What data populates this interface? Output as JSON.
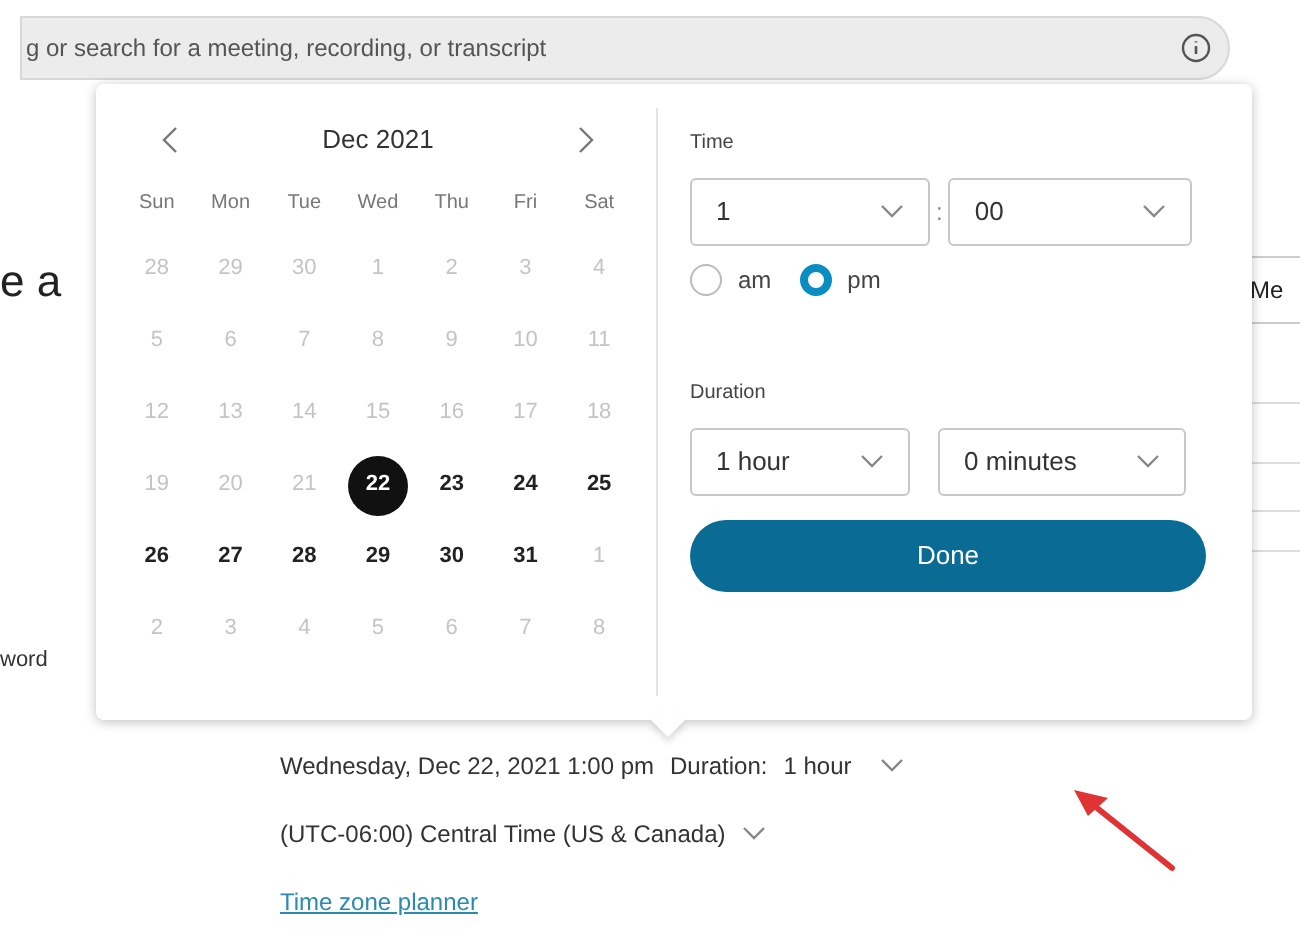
{
  "search": {
    "placeholder": "g or search for a meeting, recording, or transcript"
  },
  "background": {
    "heading": "e a",
    "field_label": "word",
    "column_label": "Me"
  },
  "calendar": {
    "month": "Dec 2021",
    "weekdays": [
      "Sun",
      "Mon",
      "Tue",
      "Wed",
      "Thu",
      "Fri",
      "Sat"
    ],
    "weeks": [
      [
        {
          "day": "28",
          "disabled": true,
          "selected": false
        },
        {
          "day": "29",
          "disabled": true,
          "selected": false
        },
        {
          "day": "30",
          "disabled": true,
          "selected": false
        },
        {
          "day": "1",
          "disabled": true,
          "selected": false
        },
        {
          "day": "2",
          "disabled": true,
          "selected": false
        },
        {
          "day": "3",
          "disabled": true,
          "selected": false
        },
        {
          "day": "4",
          "disabled": true,
          "selected": false
        }
      ],
      [
        {
          "day": "5",
          "disabled": true,
          "selected": false
        },
        {
          "day": "6",
          "disabled": true,
          "selected": false
        },
        {
          "day": "7",
          "disabled": true,
          "selected": false
        },
        {
          "day": "8",
          "disabled": true,
          "selected": false
        },
        {
          "day": "9",
          "disabled": true,
          "selected": false
        },
        {
          "day": "10",
          "disabled": true,
          "selected": false
        },
        {
          "day": "11",
          "disabled": true,
          "selected": false
        }
      ],
      [
        {
          "day": "12",
          "disabled": true,
          "selected": false
        },
        {
          "day": "13",
          "disabled": true,
          "selected": false
        },
        {
          "day": "14",
          "disabled": true,
          "selected": false
        },
        {
          "day": "15",
          "disabled": true,
          "selected": false
        },
        {
          "day": "16",
          "disabled": true,
          "selected": false
        },
        {
          "day": "17",
          "disabled": true,
          "selected": false
        },
        {
          "day": "18",
          "disabled": true,
          "selected": false
        }
      ],
      [
        {
          "day": "19",
          "disabled": true,
          "selected": false
        },
        {
          "day": "20",
          "disabled": true,
          "selected": false
        },
        {
          "day": "21",
          "disabled": true,
          "selected": false
        },
        {
          "day": "22",
          "disabled": false,
          "selected": true
        },
        {
          "day": "23",
          "disabled": false,
          "selected": false
        },
        {
          "day": "24",
          "disabled": false,
          "selected": false
        },
        {
          "day": "25",
          "disabled": false,
          "selected": false
        }
      ],
      [
        {
          "day": "26",
          "disabled": false,
          "selected": false
        },
        {
          "day": "27",
          "disabled": false,
          "selected": false
        },
        {
          "day": "28",
          "disabled": false,
          "selected": false
        },
        {
          "day": "29",
          "disabled": false,
          "selected": false
        },
        {
          "day": "30",
          "disabled": false,
          "selected": false
        },
        {
          "day": "31",
          "disabled": false,
          "selected": false
        },
        {
          "day": "1",
          "disabled": true,
          "selected": false
        }
      ],
      [
        {
          "day": "2",
          "disabled": true,
          "selected": false
        },
        {
          "day": "3",
          "disabled": true,
          "selected": false
        },
        {
          "day": "4",
          "disabled": true,
          "selected": false
        },
        {
          "day": "5",
          "disabled": true,
          "selected": false
        },
        {
          "day": "6",
          "disabled": true,
          "selected": false
        },
        {
          "day": "7",
          "disabled": true,
          "selected": false
        },
        {
          "day": "8",
          "disabled": true,
          "selected": false
        }
      ]
    ]
  },
  "time": {
    "label": "Time",
    "hour": "1",
    "separator": ":",
    "minute": "00",
    "periods": [
      {
        "label": "am",
        "selected": false
      },
      {
        "label": "pm",
        "selected": true
      }
    ]
  },
  "duration": {
    "label": "Duration",
    "hours": "1 hour",
    "minutes": "0 minutes"
  },
  "done_button": "Done",
  "summary": {
    "date_time": "Wednesday, Dec 22, 2021 1:00 pm",
    "duration_label": "Duration:",
    "duration_value": "1 hour"
  },
  "timezone": "(UTC-06:00) Central Time (US & Canada)",
  "timezone_link": "Time zone planner"
}
